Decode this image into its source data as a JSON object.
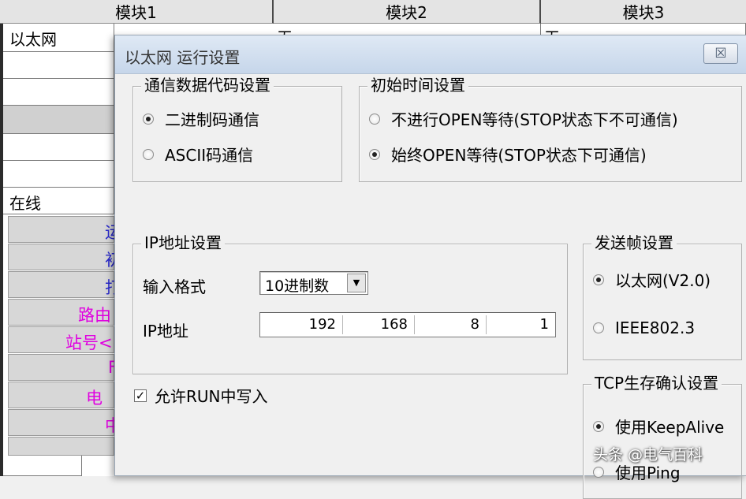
{
  "background": {
    "columns": [
      "模块1",
      "模块2",
      "模块3"
    ],
    "module1_value": "以太网",
    "module2_value": "无",
    "module3_value": "无",
    "status_value": "在线",
    "left_buttons": [
      "运",
      "初",
      "打",
      "路由",
      "站号<",
      "F",
      "电子",
      "中"
    ]
  },
  "dialog": {
    "title": "以太网 运行设置",
    "close_glyph": "☒",
    "comm_code": {
      "label": "通信数据代码设置",
      "options": [
        "二进制码通信",
        "ASCII码通信"
      ],
      "selected_index": 0
    },
    "initial_timing": {
      "label": "初始时间设置",
      "options": [
        "不进行OPEN等待(STOP状态下不可通信)",
        "始终OPEN等待(STOP状态下可通信)"
      ],
      "selected_index": 1
    },
    "ip_settings": {
      "label": "IP地址设置",
      "input_format_label": "输入格式",
      "input_format_value": "10进制数",
      "ip_label": "IP地址",
      "octets": [
        "192",
        "168",
        "8",
        "1"
      ]
    },
    "send_frame": {
      "label": "发送帧设置",
      "options": [
        "以太网(V2.0)",
        "IEEE802.3"
      ],
      "selected_index": 0
    },
    "tcp_keepalive": {
      "label": "TCP生存确认设置",
      "options": [
        "使用KeepAlive",
        "使用Ping"
      ],
      "selected_index": 0
    },
    "allow_run_write": {
      "label": "允许RUN中写入",
      "checked": true
    }
  },
  "watermark": "头条 @电气百科",
  "colors": {
    "accent_magenta": "#e000e0",
    "accent_blue": "#2a2acc",
    "title_gradient_top": "#dfe9f5",
    "dialog_bg": "#f0f0f0"
  }
}
